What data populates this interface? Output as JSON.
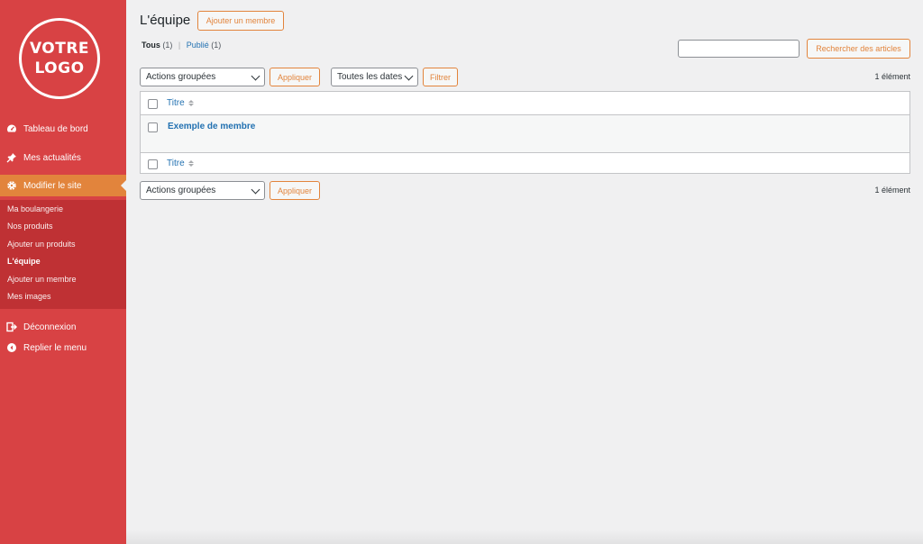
{
  "sidebar": {
    "logo_line1": "VOTRE",
    "logo_line2": "LOGO",
    "menu": [
      {
        "label": "Tableau de bord",
        "icon": "dashboard-icon"
      },
      {
        "label": "Mes actualités",
        "icon": "pin-icon"
      },
      {
        "label": "Modifier le site",
        "icon": "gear-icon",
        "active": true
      },
      {
        "label": "Déconnexion",
        "icon": "logout-icon"
      },
      {
        "label": "Replier le menu",
        "icon": "collapse-icon"
      }
    ],
    "submenu": [
      {
        "label": "Ma boulangerie"
      },
      {
        "label": "Nos produits"
      },
      {
        "label": "Ajouter un produits"
      },
      {
        "label": "L'équipe",
        "current": true
      },
      {
        "label": "Ajouter un membre"
      },
      {
        "label": "Mes images"
      }
    ]
  },
  "header": {
    "title": "L'équipe",
    "add_button": "Ajouter un membre"
  },
  "filters": {
    "all_label": "Tous",
    "all_count": "(1)",
    "separator": "|",
    "published_label": "Publié",
    "published_count": "(1)"
  },
  "search": {
    "value": "",
    "button": "Rechercher des articles"
  },
  "tablenav_top": {
    "bulk_actions": "Actions groupées",
    "apply": "Appliquer",
    "dates": "Toutes les dates",
    "filter": "Filtrer",
    "count": "1 élément"
  },
  "table": {
    "column_title": "Titre",
    "rows": [
      {
        "title": "Exemple de membre"
      }
    ]
  },
  "tablenav_bottom": {
    "bulk_actions": "Actions groupées",
    "apply": "Appliquer",
    "count": "1 élément"
  },
  "colors": {
    "sidebar_bg": "#d84244",
    "submenu_bg": "#bf3134",
    "active_item": "#e2843c",
    "accent": "#e2843c",
    "link": "#2271b1"
  }
}
